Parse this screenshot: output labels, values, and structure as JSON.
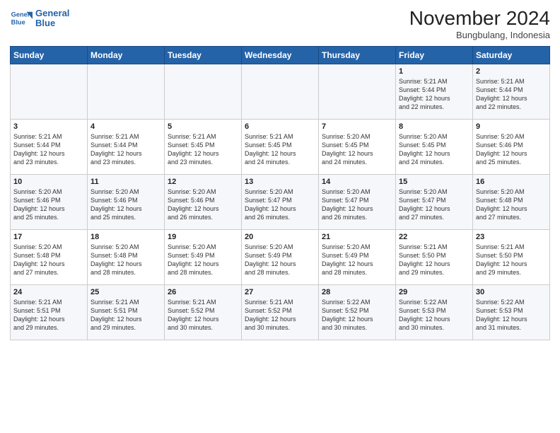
{
  "header": {
    "logo_line1": "General",
    "logo_line2": "Blue",
    "month": "November 2024",
    "location": "Bungbulang, Indonesia"
  },
  "weekdays": [
    "Sunday",
    "Monday",
    "Tuesday",
    "Wednesday",
    "Thursday",
    "Friday",
    "Saturday"
  ],
  "weeks": [
    [
      {
        "day": "",
        "text": ""
      },
      {
        "day": "",
        "text": ""
      },
      {
        "day": "",
        "text": ""
      },
      {
        "day": "",
        "text": ""
      },
      {
        "day": "",
        "text": ""
      },
      {
        "day": "1",
        "text": "Sunrise: 5:21 AM\nSunset: 5:44 PM\nDaylight: 12 hours\nand 22 minutes."
      },
      {
        "day": "2",
        "text": "Sunrise: 5:21 AM\nSunset: 5:44 PM\nDaylight: 12 hours\nand 22 minutes."
      }
    ],
    [
      {
        "day": "3",
        "text": "Sunrise: 5:21 AM\nSunset: 5:44 PM\nDaylight: 12 hours\nand 23 minutes."
      },
      {
        "day": "4",
        "text": "Sunrise: 5:21 AM\nSunset: 5:44 PM\nDaylight: 12 hours\nand 23 minutes."
      },
      {
        "day": "5",
        "text": "Sunrise: 5:21 AM\nSunset: 5:45 PM\nDaylight: 12 hours\nand 23 minutes."
      },
      {
        "day": "6",
        "text": "Sunrise: 5:21 AM\nSunset: 5:45 PM\nDaylight: 12 hours\nand 24 minutes."
      },
      {
        "day": "7",
        "text": "Sunrise: 5:20 AM\nSunset: 5:45 PM\nDaylight: 12 hours\nand 24 minutes."
      },
      {
        "day": "8",
        "text": "Sunrise: 5:20 AM\nSunset: 5:45 PM\nDaylight: 12 hours\nand 24 minutes."
      },
      {
        "day": "9",
        "text": "Sunrise: 5:20 AM\nSunset: 5:46 PM\nDaylight: 12 hours\nand 25 minutes."
      }
    ],
    [
      {
        "day": "10",
        "text": "Sunrise: 5:20 AM\nSunset: 5:46 PM\nDaylight: 12 hours\nand 25 minutes."
      },
      {
        "day": "11",
        "text": "Sunrise: 5:20 AM\nSunset: 5:46 PM\nDaylight: 12 hours\nand 25 minutes."
      },
      {
        "day": "12",
        "text": "Sunrise: 5:20 AM\nSunset: 5:46 PM\nDaylight: 12 hours\nand 26 minutes."
      },
      {
        "day": "13",
        "text": "Sunrise: 5:20 AM\nSunset: 5:47 PM\nDaylight: 12 hours\nand 26 minutes."
      },
      {
        "day": "14",
        "text": "Sunrise: 5:20 AM\nSunset: 5:47 PM\nDaylight: 12 hours\nand 26 minutes."
      },
      {
        "day": "15",
        "text": "Sunrise: 5:20 AM\nSunset: 5:47 PM\nDaylight: 12 hours\nand 27 minutes."
      },
      {
        "day": "16",
        "text": "Sunrise: 5:20 AM\nSunset: 5:48 PM\nDaylight: 12 hours\nand 27 minutes."
      }
    ],
    [
      {
        "day": "17",
        "text": "Sunrise: 5:20 AM\nSunset: 5:48 PM\nDaylight: 12 hours\nand 27 minutes."
      },
      {
        "day": "18",
        "text": "Sunrise: 5:20 AM\nSunset: 5:48 PM\nDaylight: 12 hours\nand 28 minutes."
      },
      {
        "day": "19",
        "text": "Sunrise: 5:20 AM\nSunset: 5:49 PM\nDaylight: 12 hours\nand 28 minutes."
      },
      {
        "day": "20",
        "text": "Sunrise: 5:20 AM\nSunset: 5:49 PM\nDaylight: 12 hours\nand 28 minutes."
      },
      {
        "day": "21",
        "text": "Sunrise: 5:20 AM\nSunset: 5:49 PM\nDaylight: 12 hours\nand 28 minutes."
      },
      {
        "day": "22",
        "text": "Sunrise: 5:21 AM\nSunset: 5:50 PM\nDaylight: 12 hours\nand 29 minutes."
      },
      {
        "day": "23",
        "text": "Sunrise: 5:21 AM\nSunset: 5:50 PM\nDaylight: 12 hours\nand 29 minutes."
      }
    ],
    [
      {
        "day": "24",
        "text": "Sunrise: 5:21 AM\nSunset: 5:51 PM\nDaylight: 12 hours\nand 29 minutes."
      },
      {
        "day": "25",
        "text": "Sunrise: 5:21 AM\nSunset: 5:51 PM\nDaylight: 12 hours\nand 29 minutes."
      },
      {
        "day": "26",
        "text": "Sunrise: 5:21 AM\nSunset: 5:52 PM\nDaylight: 12 hours\nand 30 minutes."
      },
      {
        "day": "27",
        "text": "Sunrise: 5:21 AM\nSunset: 5:52 PM\nDaylight: 12 hours\nand 30 minutes."
      },
      {
        "day": "28",
        "text": "Sunrise: 5:22 AM\nSunset: 5:52 PM\nDaylight: 12 hours\nand 30 minutes."
      },
      {
        "day": "29",
        "text": "Sunrise: 5:22 AM\nSunset: 5:53 PM\nDaylight: 12 hours\nand 30 minutes."
      },
      {
        "day": "30",
        "text": "Sunrise: 5:22 AM\nSunset: 5:53 PM\nDaylight: 12 hours\nand 31 minutes."
      }
    ]
  ]
}
